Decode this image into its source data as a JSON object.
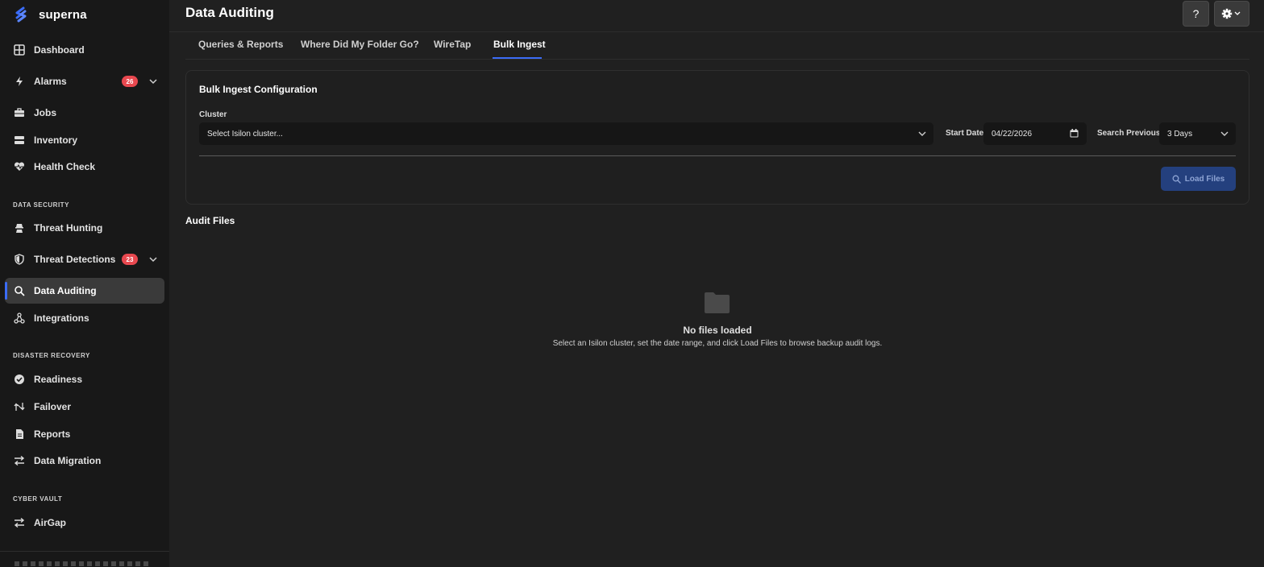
{
  "brand": {
    "name": "superna",
    "color": "#3b6cf6"
  },
  "sidebar": {
    "items": [
      {
        "label": "Dashboard",
        "icon": "grid-icon"
      },
      {
        "label": "Alarms",
        "icon": "bolt-icon",
        "badge": "26"
      },
      {
        "label": "Jobs",
        "icon": "briefcase-icon"
      },
      {
        "label": "Inventory",
        "icon": "server-icon"
      },
      {
        "label": "Health Check",
        "icon": "heartbeat-icon"
      }
    ],
    "sections": [
      {
        "label": "DATA SECURITY",
        "items": [
          {
            "label": "Threat Hunting",
            "icon": "spy-icon"
          },
          {
            "label": "Threat Detections",
            "icon": "shield-icon",
            "badge": "23"
          },
          {
            "label": "Data Auditing",
            "icon": "search-icon",
            "active": true
          },
          {
            "label": "Integrations",
            "icon": "network-icon"
          }
        ]
      },
      {
        "label": "DISASTER RECOVERY",
        "items": [
          {
            "label": "Readiness",
            "icon": "check-circle-icon"
          },
          {
            "label": "Failover",
            "icon": "failover-icon"
          },
          {
            "label": "Reports",
            "icon": "file-icon"
          },
          {
            "label": "Data Migration",
            "icon": "swap-icon"
          }
        ]
      },
      {
        "label": "CYBER VAULT",
        "items": [
          {
            "label": "AirGap",
            "icon": "swap-icon"
          }
        ]
      }
    ]
  },
  "header": {
    "title": "Data Auditing",
    "help_label": "?",
    "settings_icon": "gear-icon"
  },
  "tabs": [
    {
      "label": "Queries & Reports"
    },
    {
      "label": "Where Did My Folder Go?"
    },
    {
      "label": "WireTap"
    },
    {
      "label": "Bulk Ingest",
      "active": true
    }
  ],
  "config": {
    "title": "Bulk Ingest Configuration",
    "cluster_label": "Cluster",
    "cluster_value": "Select Isilon cluster...",
    "start_date_label": "Start Date",
    "start_date_value": "04/22/2026",
    "search_previous_label": "Search Previous",
    "search_previous_value": "3 Days",
    "load_button_label": "Load Files"
  },
  "audit": {
    "title": "Audit Files",
    "empty_title": "No files loaded",
    "empty_message": "Select an Isilon cluster, set the date range, and click Load Files to browse backup audit logs."
  },
  "colors": {
    "accent": "#3b6cf6",
    "badge": "#e8484f",
    "background": "#202020",
    "sidebar": "#181818"
  }
}
